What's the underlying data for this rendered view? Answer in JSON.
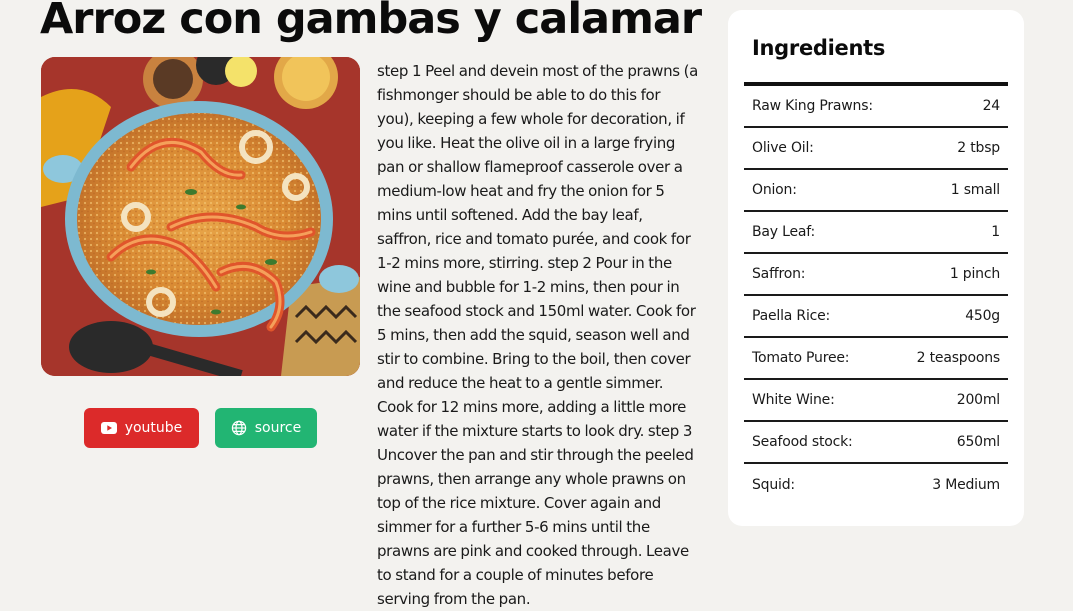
{
  "recipe": {
    "title": "Arroz con gambas y calamar",
    "image_alt": "Arroz con gambas y calamar",
    "instructions": "step 1 Peel and devein most of the prawns (a fishmonger should be able to do this for you), keeping a few whole for decoration, if you like. Heat the olive oil in a large frying pan or shallow flameproof casserole over a medium-low heat and fry the onion for 5 mins until softened. Add the bay leaf, saffron, rice and tomato purée, and cook for 1-2 mins more, stirring. step 2 Pour in the wine and bubble for 1-2 mins, then pour in the seafood stock and 150ml water. Cook for 5 mins, then add the squid, season well and stir to combine. Bring to the boil, then cover and reduce the heat to a gentle simmer. Cook for 12 mins more, adding a little more water if the mixture starts to look dry. step 3 Uncover the pan and stir through the peeled prawns, then arrange any whole prawns on top of the rice mixture. Cover again and simmer for a further 5-6 mins until the prawns are pink and cooked through. Leave to stand for a couple of minutes before serving from the pan."
  },
  "buttons": {
    "youtube": {
      "label": "youtube",
      "icon": "youtube-icon",
      "color": "#dc2a2a"
    },
    "source": {
      "label": "source",
      "icon": "globe-icon",
      "color": "#22b573"
    }
  },
  "ingredients": {
    "title": "Ingredients",
    "items": [
      {
        "name": "Raw King Prawns:",
        "measure": "24"
      },
      {
        "name": "Olive Oil:",
        "measure": "2 tbsp"
      },
      {
        "name": "Onion:",
        "measure": "1 small"
      },
      {
        "name": "Bay Leaf:",
        "measure": "1"
      },
      {
        "name": "Saffron:",
        "measure": "1 pinch"
      },
      {
        "name": "Paella Rice:",
        "measure": "450g"
      },
      {
        "name": "Tomato Puree:",
        "measure": "2 teaspoons"
      },
      {
        "name": "White Wine:",
        "measure": "200ml"
      },
      {
        "name": "Seafood stock:",
        "measure": "650ml"
      },
      {
        "name": "Squid:",
        "measure": "3 Medium"
      }
    ]
  },
  "colors": {
    "background": "#f3f2ef",
    "card": "#ffffff",
    "text": "#111111"
  }
}
